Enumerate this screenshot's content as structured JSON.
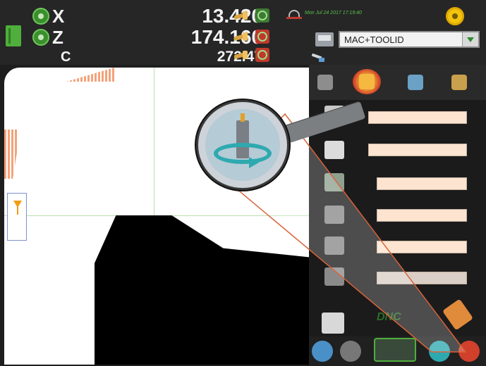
{
  "axes": [
    {
      "letter": "X",
      "value": "13.420"
    },
    {
      "letter": "Z",
      "value": "174.160"
    },
    {
      "letter": "C",
      "value": "272.47"
    }
  ],
  "header": {
    "datetime": "Mon Jul 24 2017 17:19:40"
  },
  "machine_select": {
    "selected": "MAC+TOOLID"
  },
  "panel": {
    "bottom_label": "DNC"
  },
  "colors": {
    "accent_green": "#57c24a",
    "field_fill": "#fde4d0",
    "highlight_red": "#d0402a"
  },
  "icons": [
    "book-icon",
    "axis-toggle-icon",
    "hand-jog-icon",
    "network-icon",
    "status-gear-icon",
    "machine-icon",
    "tool-icon",
    "camera-icon",
    "tool-turret-icon",
    "lathe-tool-icon",
    "measure-icon",
    "table-edit-icon",
    "printer-icon",
    "editor-icon",
    "home-icon",
    "magnifier-icon"
  ]
}
